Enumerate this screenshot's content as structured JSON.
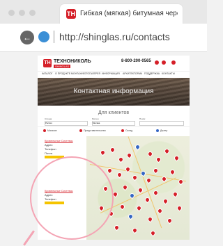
{
  "browser": {
    "tab_title": "Гибкая (мягкая) битумная черепица...",
    "url": "http://shinglas.ru/contacts"
  },
  "site": {
    "logo_name": "ТЕХНОНИКОЛЬ",
    "logo_sub": "SHINGLAS",
    "phone": "8-800-200-0565",
    "nav": [
      "КАТАЛОГ",
      "О ПРОДУКТЕ",
      "МОНТАЖ",
      "ФОТОГАЛЕРЕЯ",
      "ИНФОРМАЦИЯ",
      "АРХИТЕКТОРАМ",
      "ПОДДЕРЖКА",
      "КОНТАКТЫ"
    ],
    "hero_title": "Контактная информация",
    "clients_title": "Для клиентов",
    "filter_labels": [
      "Страна",
      "Регион",
      "Поиск"
    ],
    "filter_values": [
      "Россия",
      "Москва",
      ""
    ],
    "legend": [
      "Магазин",
      "Представительство",
      "Склад",
      "Дилер"
    ]
  },
  "list": [
    {
      "title": "Кровельные Системы",
      "lines": [
        "Адрес",
        "Телефон",
        "Почта"
      ]
    },
    {
      "title": "Кровельные Системы",
      "lines": [
        "Адрес",
        "Телефон"
      ]
    }
  ],
  "colors": {
    "brand": "#d51f28",
    "accent": "#f5c400",
    "pin_blue": "#3566c4"
  }
}
